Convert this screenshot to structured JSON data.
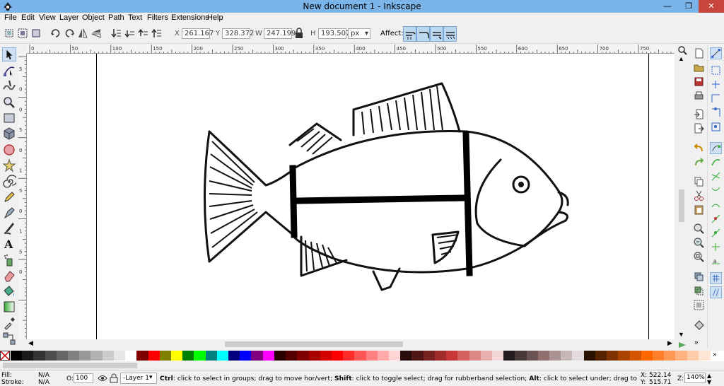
{
  "window": {
    "title": "New document 1 - Inkscape",
    "minimize": "—",
    "restore": "❐",
    "close": "✕"
  },
  "menu": [
    "File",
    "Edit",
    "View",
    "Layer",
    "Object",
    "Path",
    "Text",
    "Filters",
    "Extensions",
    "Help"
  ],
  "toolctrl": {
    "x_label": "X",
    "x_value": "261.167",
    "y_label": "Y",
    "y_value": "328.372",
    "w_label": "W",
    "w_value": "247.199",
    "h_label": "H",
    "h_value": "193.507",
    "unit": "px",
    "affect_label": "Affect:"
  },
  "ruler_top_labels": [
    "0",
    "50",
    "100",
    "150",
    "200",
    "250",
    "300",
    "350",
    "400",
    "450",
    "500",
    "550",
    "600",
    "650",
    "700",
    "750"
  ],
  "ruler_left_labels": [
    "5",
    "0",
    "0",
    "5",
    "0",
    "1",
    "5",
    "0",
    "1",
    "5",
    "0"
  ],
  "palette_colors": [
    "#000000",
    "#1a1a1a",
    "#333333",
    "#4d4d4d",
    "#666666",
    "#808080",
    "#999999",
    "#b3b3b3",
    "#cccccc",
    "#e6e6e6",
    "#ffffff",
    "#800000",
    "#ff0000",
    "#808000",
    "#ffff00",
    "#008000",
    "#00ff00",
    "#008080",
    "#00ffff",
    "#000080",
    "#0000ff",
    "#800080",
    "#ff00ff",
    "#2b0000",
    "#550000",
    "#800000",
    "#aa0000",
    "#d40000",
    "#ff0000",
    "#ff2a2a",
    "#ff5555",
    "#ff8080",
    "#ffaaaa",
    "#ffd5d5",
    "#280b0b",
    "#501616",
    "#782121",
    "#a02c2c",
    "#c83737",
    "#d35f5f",
    "#de8787",
    "#e9afaf",
    "#f4d7d7",
    "#241c1c",
    "#483737",
    "#6c5353",
    "#916f6f",
    "#ac9393",
    "#c8b7b7",
    "#e3dbdb",
    "#2b1100",
    "#552200",
    "#803300",
    "#aa4400",
    "#d45500",
    "#ff6600",
    "#ff7f2a",
    "#ff9955",
    "#ffb380",
    "#ffccaa",
    "#ffe6d5"
  ],
  "status": {
    "fill_label": "Fill:",
    "fill_value": "N/A",
    "stroke_label": "Stroke:",
    "stroke_value": "N/A",
    "opacity_label": "O:",
    "opacity_value": "100",
    "layer": "-Layer 1",
    "msg_b1": "Ctrl",
    "msg_t1": ": click to select in groups; drag to move hor/vert; ",
    "msg_b2": "Shift",
    "msg_t2": ": click to toggle select; drag for rubberband selection; ",
    "msg_b3": "Alt",
    "msg_t3": ": click to select under; drag to move selected or select by",
    "x_label": "X:",
    "x_value": "522.14",
    "y_label": "Y:",
    "y_value": "515.71",
    "zoom_label": "Z:",
    "zoom_value": "140%"
  }
}
